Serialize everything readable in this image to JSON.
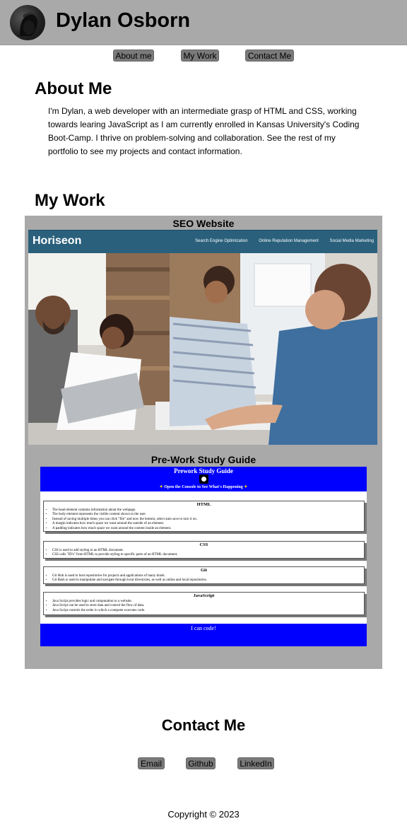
{
  "header": {
    "name": "Dylan Osborn"
  },
  "nav": {
    "about": "About me",
    "work": "My Work",
    "contact": "Contact Me"
  },
  "about": {
    "heading": "About Me",
    "text": "I'm Dylan, a web developer with an intermediate grasp of HTML and CSS, working towards learing JavaScript as I am currently enrolled in Kansas University's Coding Boot-Camp. I thrive on problem-solving and collaboration. See the rest of my portfolio to see my projects and contact information."
  },
  "work": {
    "heading": "My Work",
    "projects": [
      {
        "title": "SEO Website",
        "logo": "Horiseon",
        "links": [
          "Search Engine Optimization",
          "Online Reputation Management",
          "Social Media Marketing"
        ]
      },
      {
        "title": "Pre-Work Study Guide",
        "guide_title": "Prework Study Guide",
        "console_note": "Open the Console to See What's Happening",
        "sections": [
          {
            "title": "HTML",
            "items": [
              "The head element contains information about the webpage.",
              "The body element represents the visible content shown to the user.",
              "Instead of saving multiple times you can click \"file\" and now the bottom, select auto save to turn it on.",
              "A margin indicates how much space we want around the outside of an element.",
              "A padding indicates how much space we want around the content inside an element."
            ]
          },
          {
            "title": "CSS",
            "items": [
              "CSS is used to add styling to an HTML document.",
              "CSS calls \"ID's\" from HTML to provide styling to specific parts of an HTML document."
            ]
          },
          {
            "title": "Git",
            "items": [
              "Git Hub is used to host repositories for projects and applications of many kinds.",
              "Git Bash is used to manipulate and navigate through local directories, as well as online and local repositories."
            ]
          },
          {
            "title": "JavaScript",
            "items": [
              "Java Script provides logic and computation to a website.",
              "Java Script can be used to store data and control the flow of data.",
              "Java Script controls the order in which a computer executes code."
            ]
          }
        ],
        "footer": "I can code!"
      }
    ]
  },
  "contact": {
    "heading": "Contact Me",
    "email": "Email",
    "github": "Github",
    "linkedin": "LinkedIn"
  },
  "footer": {
    "copyright": "Copyright © 2023"
  },
  "colors": {
    "header_bg": "#a9a9a9",
    "button_bg": "#7a7a7a",
    "study_blue": "#0000ff",
    "horiseon_bar": "#2a607c"
  }
}
